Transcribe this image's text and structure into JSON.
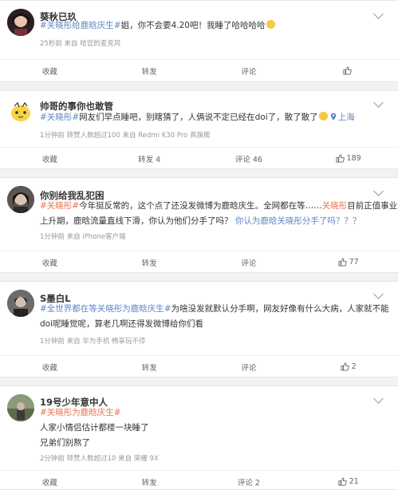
{
  "posts": [
    {
      "name": "葵秋已玖",
      "text": {
        "tag": "#关晓彤给鹿晗庆生#",
        "body": "姐，你不会要4.20吧！我睡了哈哈哈哈"
      },
      "meta": "25秒前  来自 哈宫的麦克风",
      "actions": {
        "forward": "转发",
        "comment": "评论",
        "like": ""
      },
      "collect": "收藏"
    },
    {
      "name": "帅哥的事你也敢管",
      "text": {
        "tag": "#关晓彤#",
        "body": "网友们早点睡吧，别瞎猜了，人俩说不定已经在doi了，散了散了",
        "location": "上海"
      },
      "meta": "1分钟前  转赞人数超过100  来自 Redmi K30 Pro 真旗舰",
      "actions": {
        "forward": "转发 4",
        "comment": "评论 46",
        "like": "189"
      },
      "collect": "收藏"
    },
    {
      "name": "你别给我乱犯困",
      "text": {
        "tag": "#关晓彤#",
        "line1": "今年挺反常的，这个点了还没发微博为鹿晗庆生。全网都在等……",
        "tag2": "关晓彤",
        "line1b": "目前正值事业",
        "line2": "上升期，鹿晗流量直线下滑，你认为他们分手了吗？",
        "question": "你认为鹿晗关晓彤分手了吗？？？"
      },
      "meta": "1分钟前  来自 iPhone客户端",
      "actions": {
        "forward": "转发",
        "comment": "评论",
        "like": "77"
      },
      "collect": "收藏"
    },
    {
      "name": "S墨白L",
      "text": {
        "tag": "#全世界都在等关晓彤为鹿晗庆生#",
        "line1": "为啥没发就默认分手啊，网友好像有什么大病，人家就不能",
        "line2": "doi呢睡觉呢，算老几啊还得发微博给你们看"
      },
      "meta": "1分钟前  来自 华为手机 畅享玩不停",
      "actions": {
        "forward": "转发",
        "comment": "评论",
        "like": "2"
      },
      "collect": "收藏"
    },
    {
      "name": "19号少年意中人",
      "text": {
        "tag": "#关晓彤为鹿晗庆生#",
        "line1": "人家小情侣估计都楼一块睡了",
        "line2": "兄弟们别熬了"
      },
      "meta": "2分钟前  转赞人数超过10  来自 荣耀 9X",
      "actions": {
        "forward": "转发",
        "comment": "评论 2",
        "like": "21"
      },
      "collect": "收藏"
    }
  ],
  "colors": {
    "highlight": "#eb7350",
    "link": "#5d86c4",
    "meta": "#999999"
  },
  "icons": [
    "chevron-down-icon",
    "like-icon",
    "location-pin-icon",
    "grin-emoji-icon"
  ]
}
